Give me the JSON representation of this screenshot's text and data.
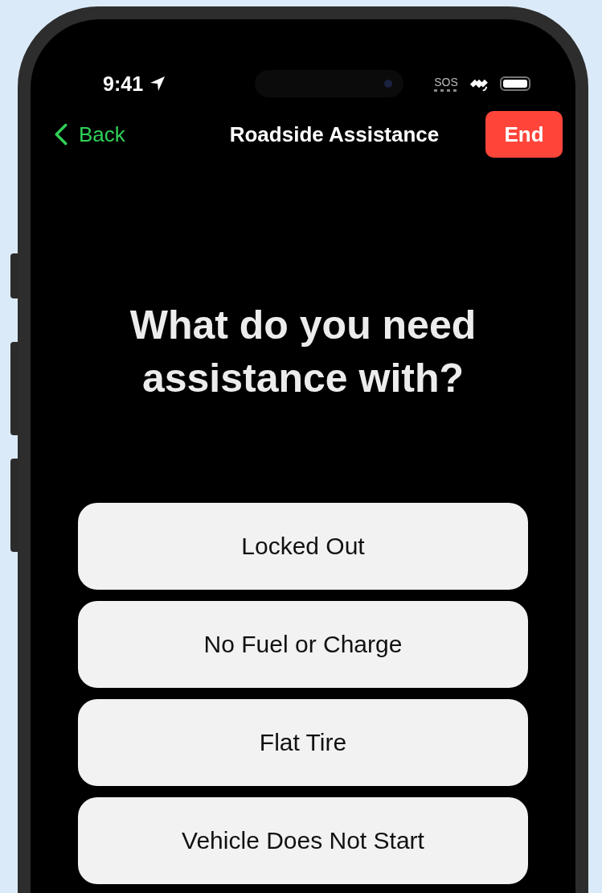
{
  "status_bar": {
    "time": "9:41",
    "sos": "SOS"
  },
  "nav": {
    "back": "Back",
    "title": "Roadside Assistance",
    "end": "End"
  },
  "heading": "What do you need assistance with?",
  "options": [
    {
      "label": "Locked Out"
    },
    {
      "label": "No Fuel or Charge"
    },
    {
      "label": "Flat Tire"
    },
    {
      "label": "Vehicle Does Not Start"
    }
  ]
}
